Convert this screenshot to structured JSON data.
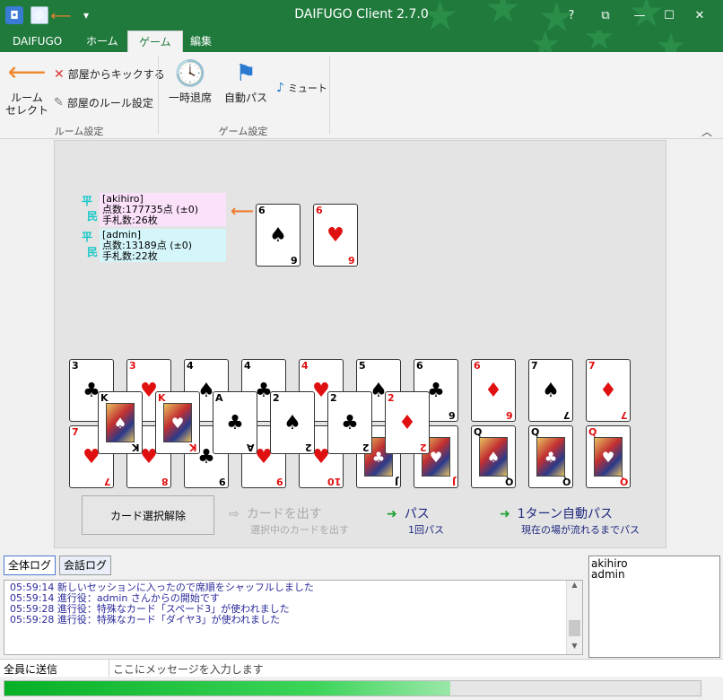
{
  "window": {
    "title": "DAIFUGO Client 2.7.0",
    "help": "?",
    "minimize": "—",
    "maximize": "☐",
    "close": "✕",
    "restore": "⧉",
    "qa_menu": "▾"
  },
  "tabs": [
    {
      "label": "DAIFUGO"
    },
    {
      "label": "ホーム"
    },
    {
      "label": "ゲーム"
    },
    {
      "label": "編集"
    }
  ],
  "ribbon": {
    "room_select_1": "ルーム",
    "room_select_2": "セレクト",
    "kick": "部屋からキックする",
    "room_rules": "部屋のルール設定",
    "group_room": "ルーム設定",
    "leave": "一時退席",
    "auto_pass": "自動パス",
    "mute": "ミュート",
    "group_game": "ゲーム設定",
    "collapse": "︿"
  },
  "players": [
    {
      "rank_1": "平",
      "rank_2": "民",
      "name": "[akihiro]",
      "score": "点数:177735点 (±0)",
      "hand": "手札数:26枚",
      "bg": "#fce1fb",
      "turn_arrow": "⟵"
    },
    {
      "rank_1": "平",
      "rank_2": "民",
      "name": "[admin]",
      "score": "点数:13189点 (±0)",
      "hand": "手札数:22枚",
      "bg": "#d4f6fa"
    }
  ],
  "field_cards": [
    {
      "rank": "6",
      "suit": "♠",
      "color": "black"
    },
    {
      "rank": "6",
      "suit": "♥",
      "color": "red"
    }
  ],
  "hand_row1": [
    {
      "rank": "3",
      "suit": "♣",
      "color": "black"
    },
    {
      "rank": "3",
      "suit": "♥",
      "color": "red"
    },
    {
      "rank": "4",
      "suit": "♠",
      "color": "black"
    },
    {
      "rank": "4",
      "suit": "♣",
      "color": "black"
    },
    {
      "rank": "4",
      "suit": "♥",
      "color": "red"
    },
    {
      "rank": "5",
      "suit": "♠",
      "color": "black"
    },
    {
      "rank": "6",
      "suit": "♣",
      "color": "black"
    },
    {
      "rank": "6",
      "suit": "♦",
      "color": "red"
    },
    {
      "rank": "7",
      "suit": "♠",
      "color": "black"
    },
    {
      "rank": "7",
      "suit": "♦",
      "color": "red"
    }
  ],
  "hand_row2": [
    {
      "rank": "7",
      "suit": "♥",
      "color": "red"
    },
    {
      "rank": "8",
      "suit": "♥",
      "color": "red"
    },
    {
      "rank": "9",
      "suit": "♣",
      "color": "black"
    },
    {
      "rank": "9",
      "suit": "♥",
      "color": "red"
    },
    {
      "rank": "10",
      "suit": "♥",
      "color": "red"
    },
    {
      "rank": "J",
      "suit": "♣",
      "color": "black"
    },
    {
      "rank": "J",
      "suit": "♥",
      "color": "red"
    },
    {
      "rank": "Q",
      "suit": "♠",
      "color": "black"
    },
    {
      "rank": "Q",
      "suit": "♣",
      "color": "black"
    },
    {
      "rank": "Q",
      "suit": "♥",
      "color": "red"
    }
  ],
  "hand_row_mid": [
    {
      "rank": "K",
      "suit": "♠",
      "color": "black"
    },
    {
      "rank": "K",
      "suit": "♥",
      "color": "red"
    },
    {
      "rank": "A",
      "suit": "♣",
      "color": "black"
    },
    {
      "rank": "2",
      "suit": "♠",
      "color": "black"
    },
    {
      "rank": "2",
      "suit": "♣",
      "color": "black"
    },
    {
      "rank": "2",
      "suit": "♦",
      "color": "red"
    }
  ],
  "actions": {
    "deselect": "カード選択解除",
    "play": "カードを出す",
    "play_sub": "選択中のカードを出す",
    "pass": "パス",
    "pass_sub": "1回パス",
    "auto_pass": "1ターン自動パス",
    "auto_pass_sub": "現在の場が流れるまでパス",
    "arrow": "➜",
    "arrow_disabled": "⇨"
  },
  "log_tabs": [
    {
      "label": "全体ログ"
    },
    {
      "label": "会話ログ"
    }
  ],
  "log": [
    "05:59:14 新しいセッションに入ったので席順をシャッフルしました",
    "05:59:14 進行役：admin さんからの開始です",
    "05:59:28 進行役：特殊なカード「スペード3」が使われました",
    "05:59:28 進行役：特殊なカード「ダイヤ3」が使われました"
  ],
  "users": [
    "akihiro",
    "admin"
  ],
  "message_bar": {
    "target": "全員に送信",
    "placeholder": "ここにメッセージを入力します"
  },
  "progress": {
    "fraction": 0.64
  },
  "scroll_up": "▲",
  "scroll_down": "▼"
}
